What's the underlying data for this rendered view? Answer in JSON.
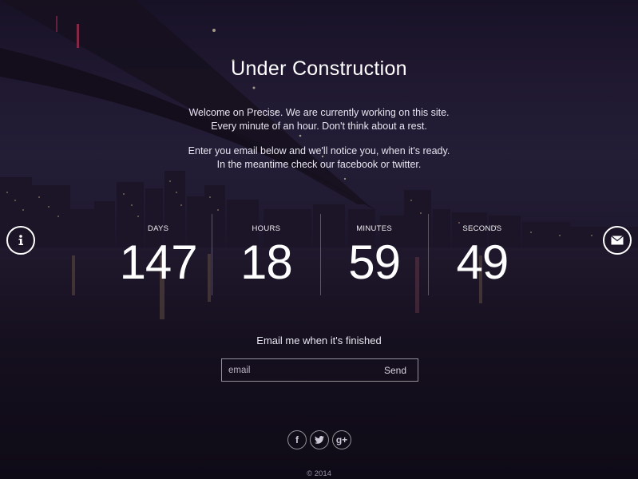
{
  "page": {
    "title": "Under Construction",
    "intro_line_1": "Welcome on Precise. We are currently working on this site.",
    "intro_line_2": "Every minute of an hour. Don't think about a rest.",
    "intro_line_3": "Enter you email below and we'll notice you, when it's ready.",
    "intro_line_4": "In the meantime check our facebook or twitter."
  },
  "countdown": [
    {
      "label": "DAYS",
      "value": "147"
    },
    {
      "label": "HOURS",
      "value": "18"
    },
    {
      "label": "MINUTES",
      "value": "59"
    },
    {
      "label": "SECONDS",
      "value": "49"
    }
  ],
  "side_buttons": {
    "left_icon": "info-icon",
    "right_icon": "envelope-icon"
  },
  "email": {
    "heading": "Email me when it's finished",
    "placeholder": "email",
    "value": "",
    "send_label": "Send"
  },
  "social": [
    {
      "icon": "facebook-icon",
      "glyph": "f"
    },
    {
      "icon": "twitter-icon",
      "glyph": ""
    },
    {
      "icon": "google-plus-icon",
      "glyph": "g+"
    }
  ],
  "footer": {
    "copyright": "© 2014"
  },
  "colors": {
    "accent": "#ffffff",
    "background": "#1a1428"
  }
}
